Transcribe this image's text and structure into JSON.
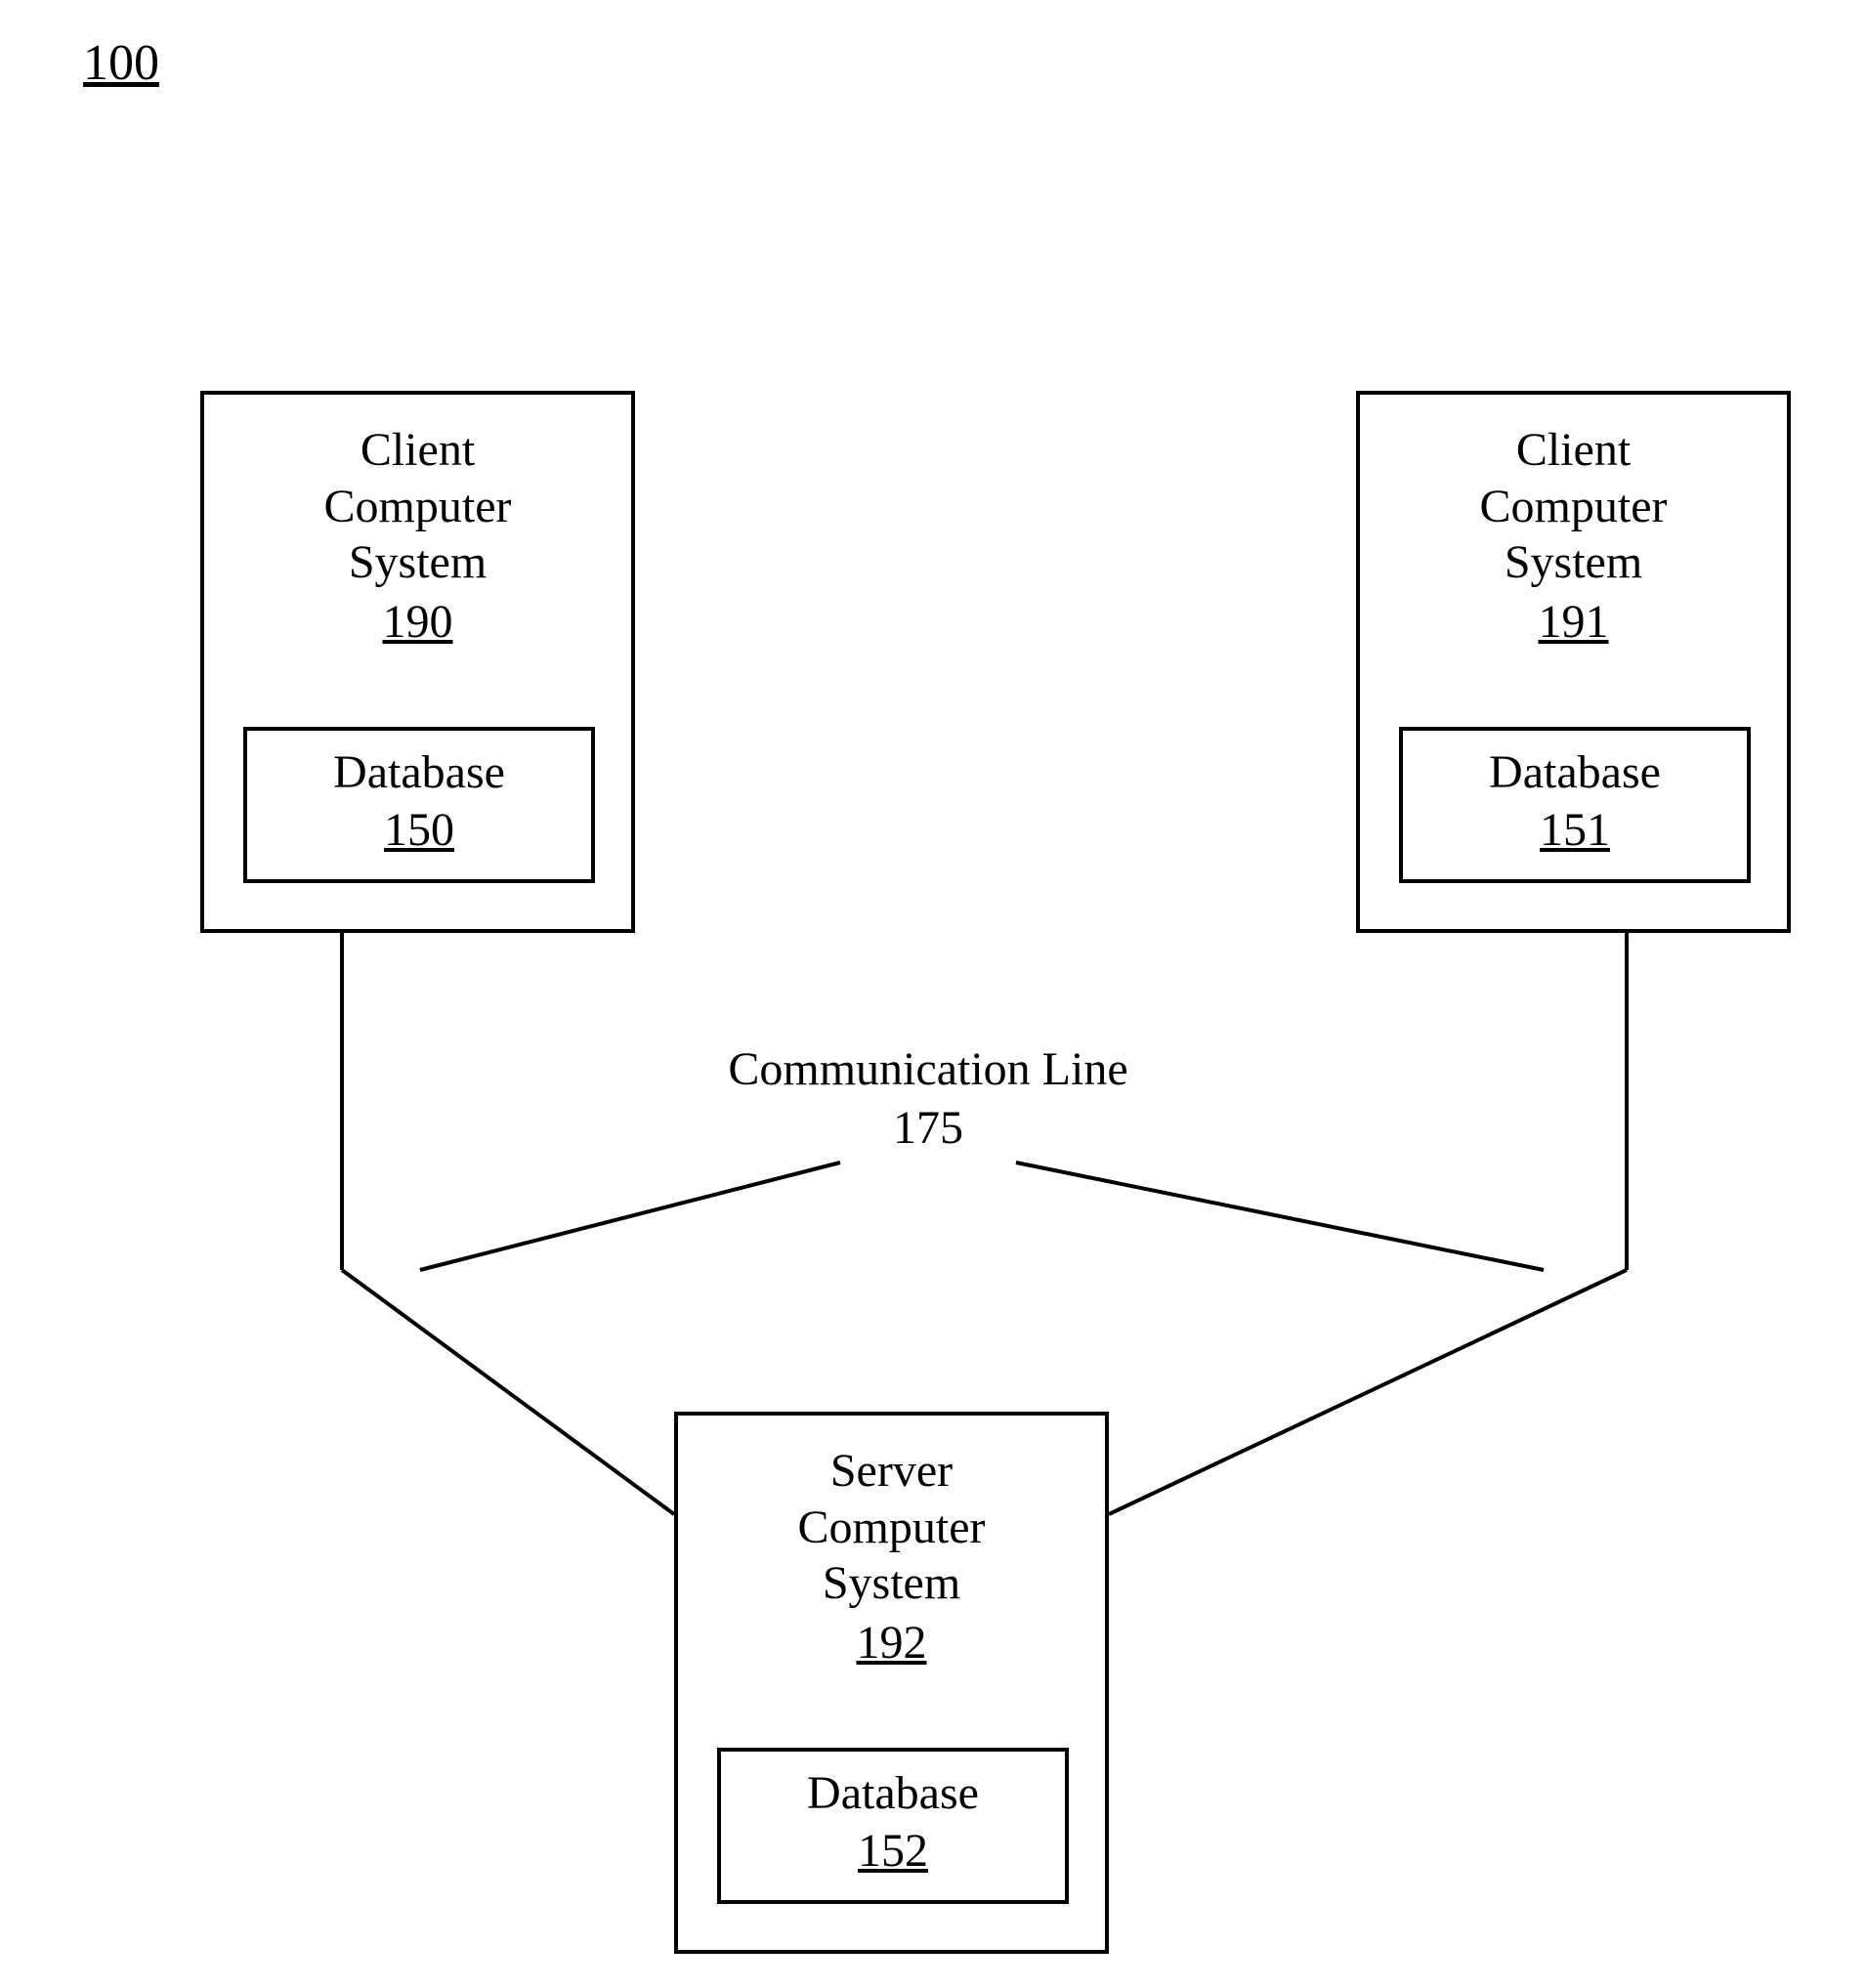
{
  "figure_number": "100",
  "client1": {
    "title_line1": "Client",
    "title_line2": "Computer",
    "title_line3": "System",
    "ref": "190",
    "db_label": "Database",
    "db_ref": "150"
  },
  "client2": {
    "title_line1": "Client",
    "title_line2": "Computer",
    "title_line3": "System",
    "ref": "191",
    "db_label": "Database",
    "db_ref": "151"
  },
  "server": {
    "title_line1": "Server",
    "title_line2": "Computer",
    "title_line3": "System",
    "ref": "192",
    "db_label": "Database",
    "db_ref": "152"
  },
  "comm": {
    "label": "Communication Line",
    "ref": "175"
  }
}
